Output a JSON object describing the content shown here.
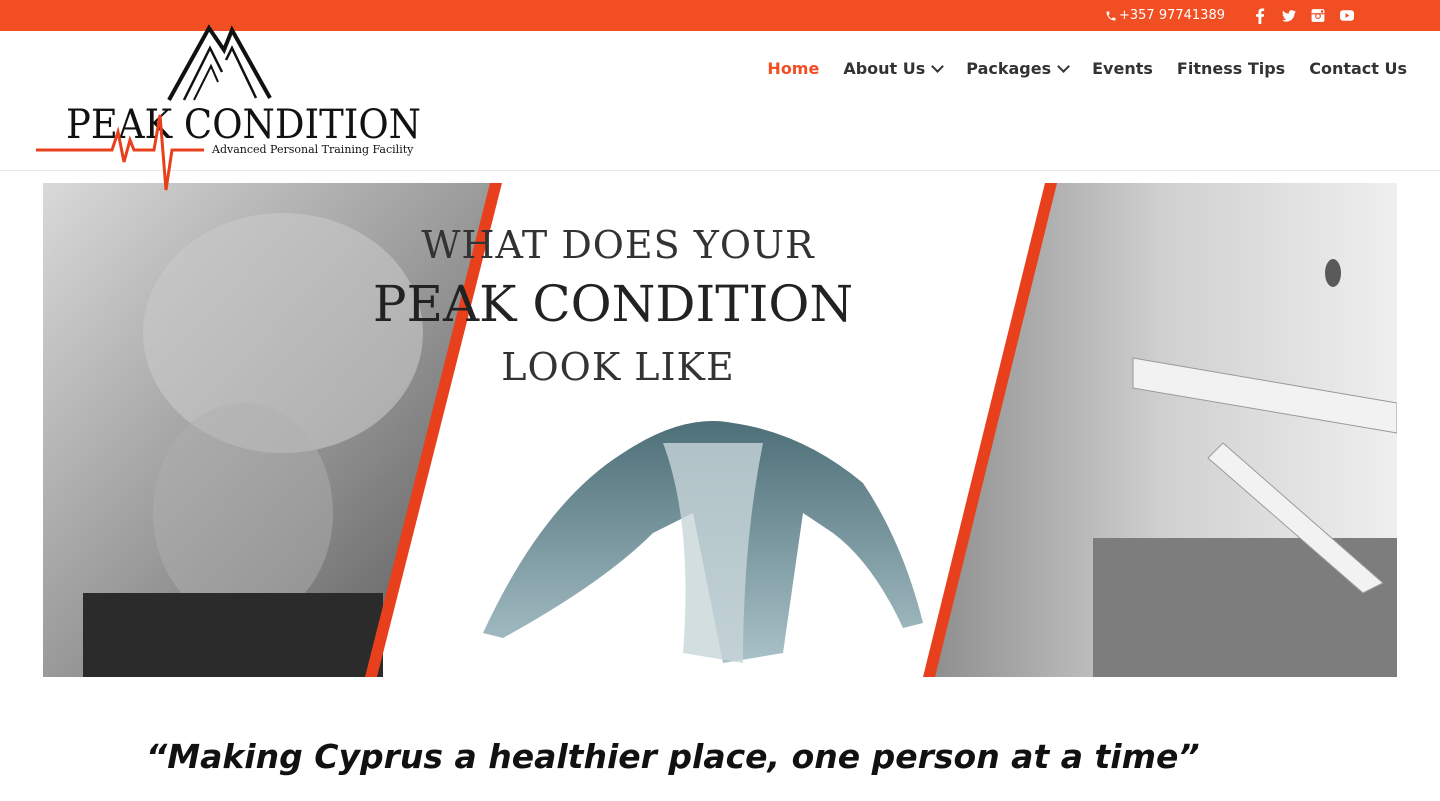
{
  "topbar": {
    "phone": "+357 97741389",
    "social_icons": [
      "facebook-icon",
      "twitter-icon",
      "instagram-icon",
      "youtube-icon"
    ]
  },
  "logo": {
    "brand": "PEAK CONDITION",
    "subtitle": "Advanced Personal Training Facility"
  },
  "nav": {
    "items": [
      {
        "label": "Home",
        "active": true,
        "has_dropdown": false
      },
      {
        "label": "About Us",
        "active": false,
        "has_dropdown": true
      },
      {
        "label": "Packages",
        "active": false,
        "has_dropdown": true
      },
      {
        "label": "Events",
        "active": false,
        "has_dropdown": false
      },
      {
        "label": "Fitness Tips",
        "active": false,
        "has_dropdown": false
      },
      {
        "label": "Contact Us",
        "active": false,
        "has_dropdown": false
      }
    ]
  },
  "hero": {
    "line1": "WHAT DOES YOUR",
    "line2": "PEAK CONDITION",
    "line3": "LOOK LIKE"
  },
  "tagline": "“Making Cyprus a healthier place, one person at a time”",
  "colors": {
    "accent": "#f24e24",
    "text": "#333333"
  }
}
